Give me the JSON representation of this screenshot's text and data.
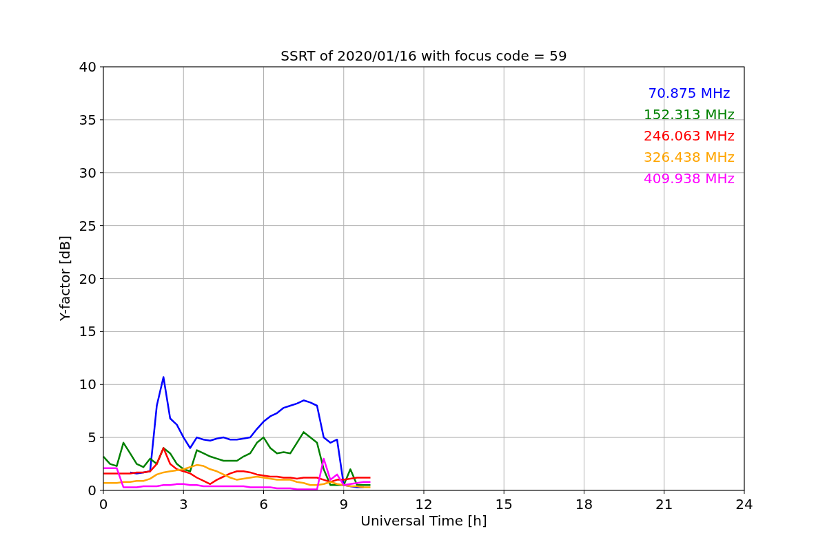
{
  "chart": {
    "chart_data": {
      "type": "line",
      "title": "SSRT of 2020/01/16 with focus code = 59",
      "xlabel": "Universal Time [h]",
      "ylabel": "Y-factor [dB]",
      "x": [
        0,
        0.25,
        0.5,
        0.75,
        1,
        1.25,
        1.5,
        1.75,
        2,
        2.25,
        2.5,
        2.75,
        3,
        3.25,
        3.5,
        3.75,
        4,
        4.25,
        4.5,
        4.75,
        5,
        5.25,
        5.5,
        5.75,
        6,
        6.25,
        6.5,
        6.75,
        7,
        7.25,
        7.5,
        7.75,
        8,
        8.25,
        8.5,
        8.75,
        9,
        9.25,
        9.5,
        9.75,
        10
      ],
      "series": [
        {
          "name": "70.875 MHz",
          "color": "#0000ff",
          "values": [
            null,
            null,
            null,
            null,
            1.7,
            1.6,
            1.7,
            1.8,
            8,
            10.7,
            6.8,
            6.2,
            5,
            4,
            5,
            4.8,
            4.7,
            4.9,
            5,
            4.8,
            4.8,
            4.9,
            5,
            5.8,
            6.5,
            7,
            7.3,
            7.8,
            8,
            8.2,
            8.5,
            8.3,
            8,
            5,
            4.5,
            4.8,
            0.5,
            0.4,
            0.3,
            0.3,
            null
          ]
        },
        {
          "name": "152.313 MHz",
          "color": "#008000",
          "values": [
            3.2,
            2.5,
            2.3,
            4.5,
            3.5,
            2.5,
            2.2,
            3,
            2.5,
            4,
            3.5,
            2.5,
            2,
            1.8,
            3.8,
            3.5,
            3.2,
            3,
            2.8,
            2.8,
            2.8,
            3.2,
            3.5,
            4.5,
            5,
            4,
            3.5,
            3.6,
            3.5,
            4.5,
            5.5,
            5,
            4.5,
            2,
            0.5,
            0.5,
            0.5,
            2,
            0.5,
            0.5,
            0.5
          ]
        },
        {
          "name": "246.063 MHz",
          "color": "#ff0000",
          "values": [
            1.6,
            1.6,
            1.6,
            1.6,
            1.6,
            1.7,
            1.7,
            1.8,
            2.5,
            4,
            2.5,
            2,
            1.8,
            1.6,
            1.2,
            0.9,
            0.6,
            1,
            1.3,
            1.6,
            1.8,
            1.8,
            1.7,
            1.5,
            1.4,
            1.3,
            1.3,
            1.2,
            1.2,
            1.1,
            1.2,
            1.2,
            1.2,
            1,
            0.8,
            1,
            1,
            1.1,
            1.2,
            1.2,
            1.2
          ]
        },
        {
          "name": "326.438 MHz",
          "color": "#ffa500",
          "values": [
            0.7,
            0.7,
            0.7,
            0.8,
            0.8,
            0.9,
            0.9,
            1.1,
            1.5,
            1.7,
            1.8,
            1.9,
            2,
            2.2,
            2.4,
            2.3,
            2,
            1.8,
            1.5,
            1.2,
            1,
            1.1,
            1.2,
            1.3,
            1.2,
            1.1,
            1,
            1,
            1,
            0.8,
            0.7,
            0.5,
            0.5,
            0.6,
            0.8,
            0.6,
            0.5,
            0.4,
            0.4,
            0.3,
            0.3
          ]
        },
        {
          "name": "409.938 MHz",
          "color": "#ff00ff",
          "values": [
            2.1,
            2.1,
            2.1,
            0.3,
            0.3,
            0.3,
            0.4,
            0.4,
            0.4,
            0.5,
            0.5,
            0.6,
            0.6,
            0.5,
            0.5,
            0.4,
            0.4,
            0.4,
            0.4,
            0.4,
            0.4,
            0.4,
            0.3,
            0.3,
            0.3,
            0.3,
            0.2,
            0.2,
            0.2,
            0.1,
            0.1,
            0.1,
            0.1,
            3,
            1,
            1.5,
            0.5,
            0.6,
            0.7,
            0.8,
            0.8
          ]
        }
      ],
      "grid": true,
      "xlim": [
        0,
        24
      ],
      "ylim": [
        0,
        40
      ],
      "xticks": [
        0,
        3,
        6,
        9,
        12,
        15,
        18,
        21,
        24
      ],
      "yticks": [
        0,
        5,
        10,
        15,
        20,
        25,
        30,
        35,
        40
      ]
    }
  }
}
